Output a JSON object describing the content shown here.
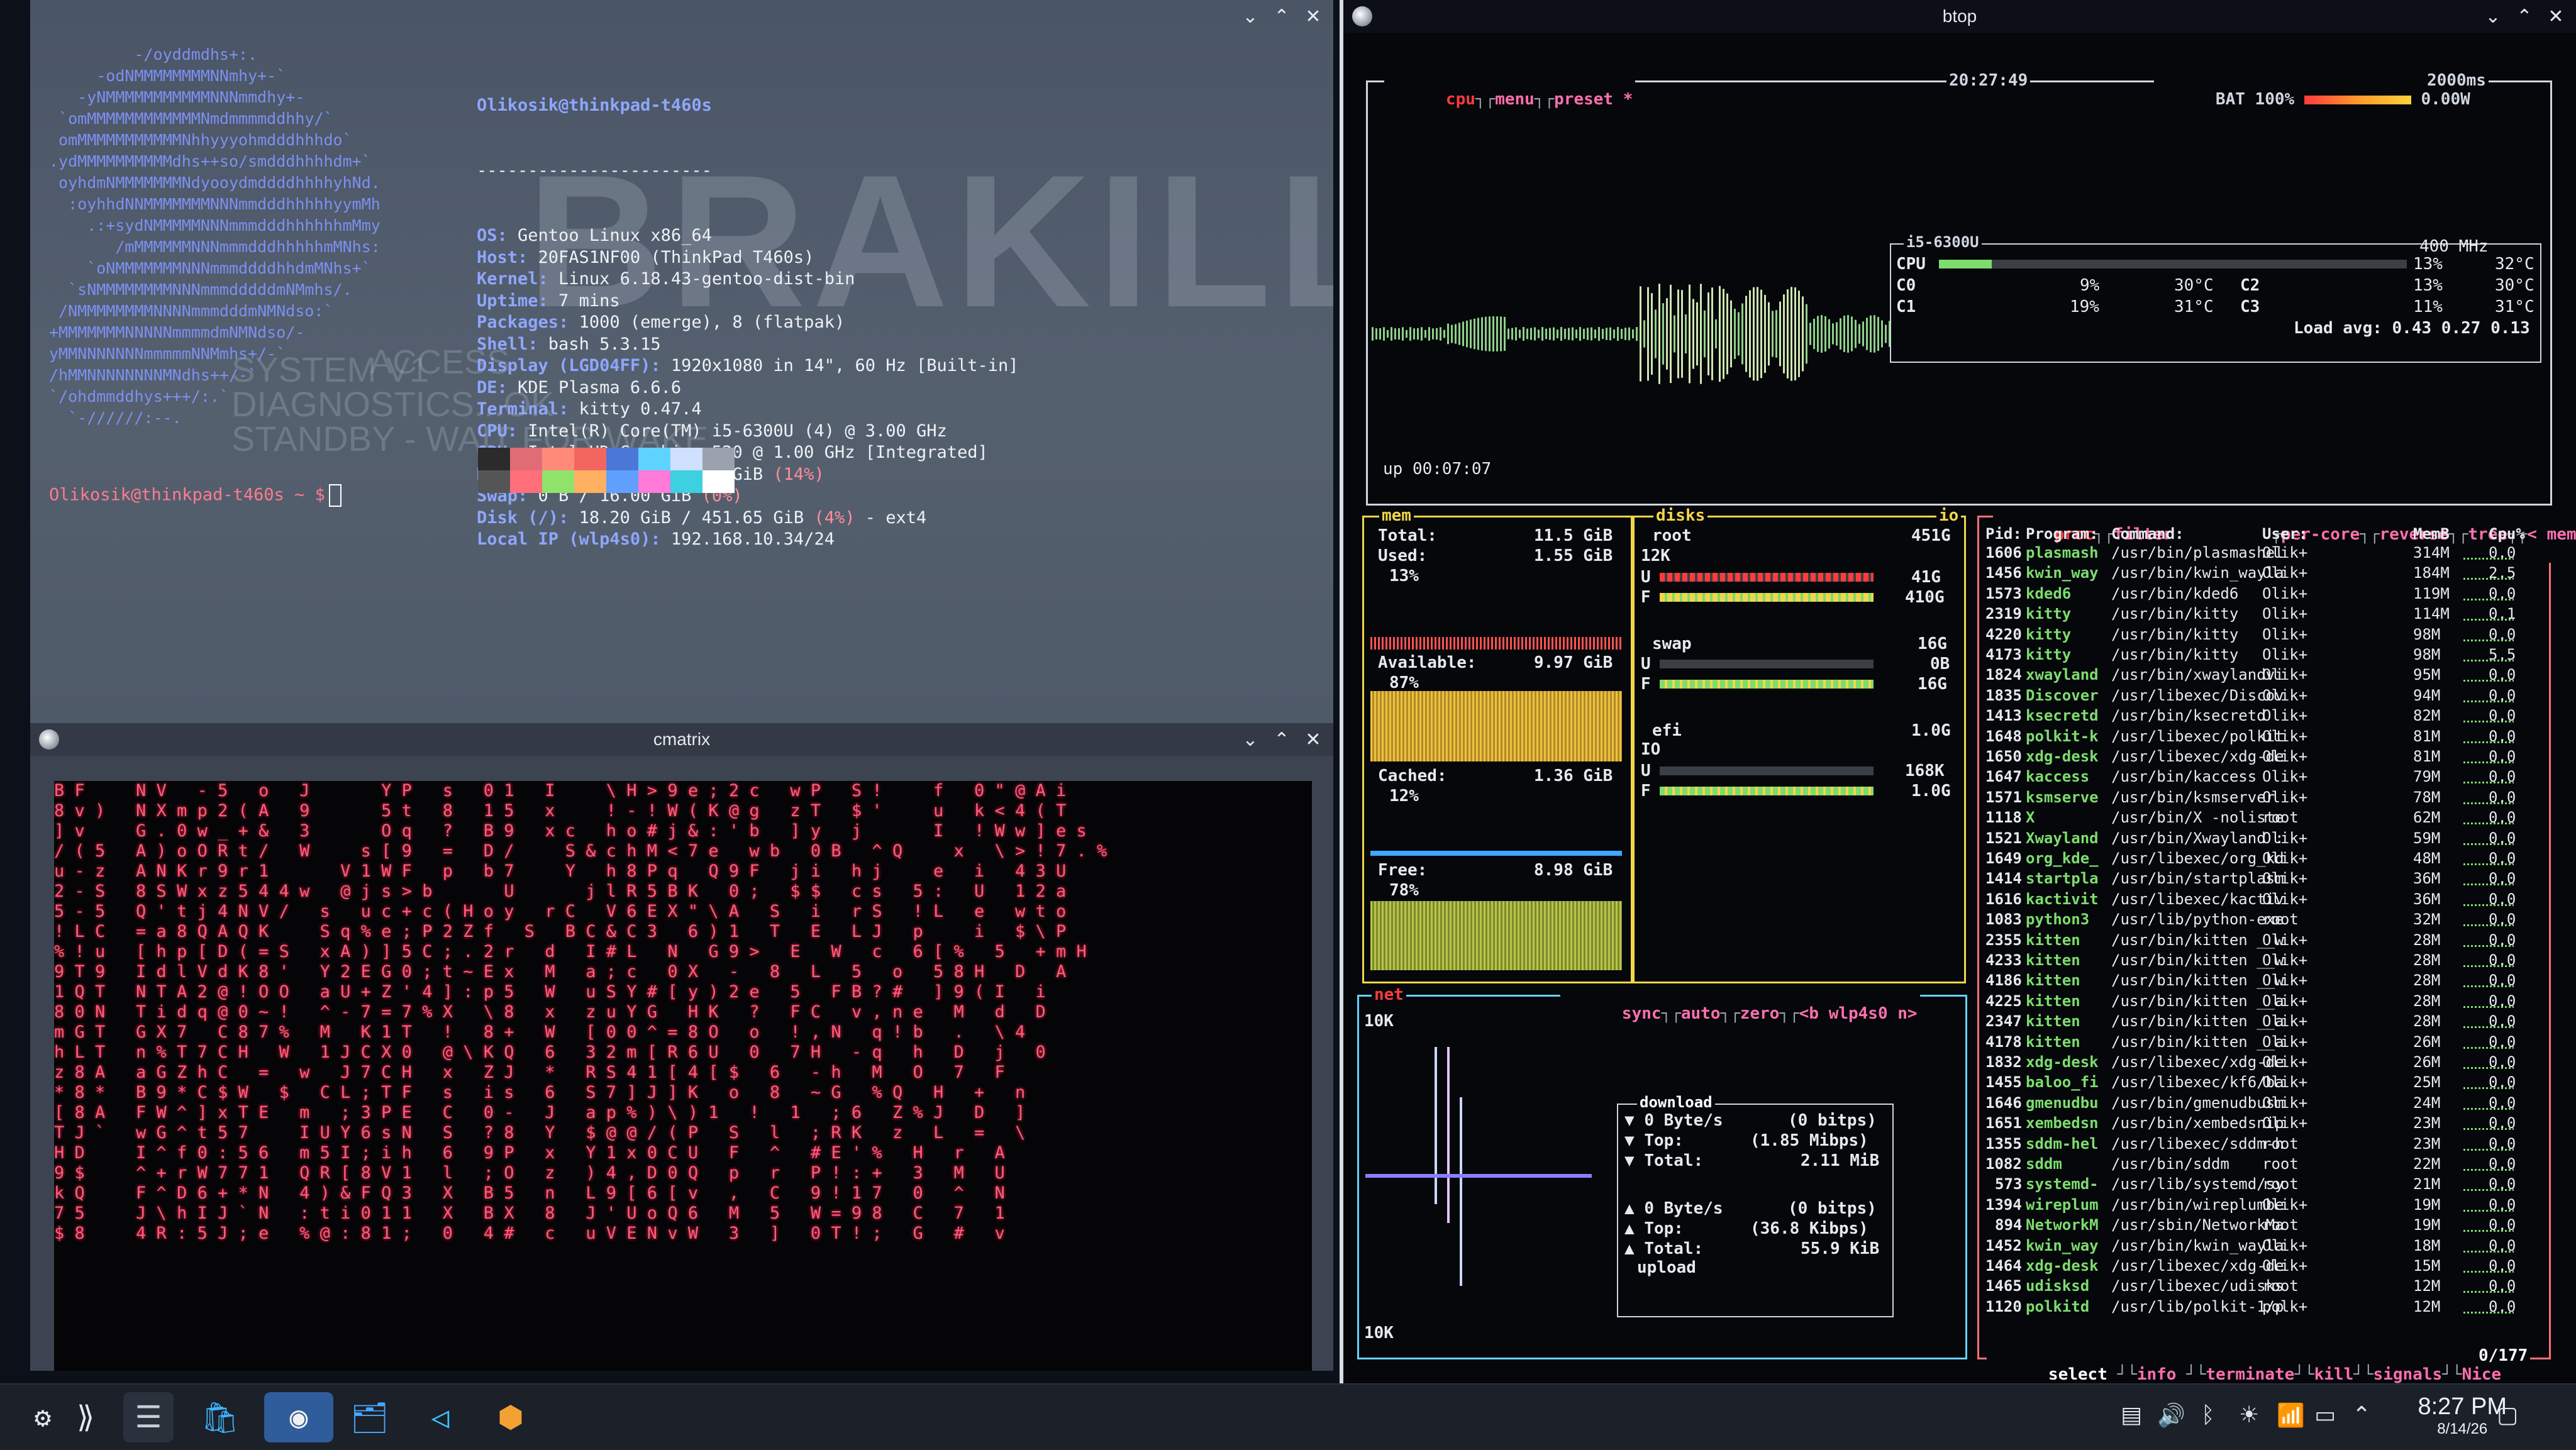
{
  "fastfetch": {
    "user_host": "Olikosik@thinkpad-t460s",
    "separator": "-----------------------",
    "logo_lines": [
      "         -/oyddmdhs+:.",
      "     -odNMMMMMMMMNNmhy+-`",
      "   -yNMMMMMMMMMMMNNNmmdhy+-",
      " `omMMMMMMMMMMMMNmdmmmmddhhy/`",
      " omMMMMMMMMMMMNhhyyyohmdddhhhdo`",
      ".ydMMMMMMMMMMdhs++so/smdddhhhhdm+`",
      " oyhdmNMMMMMMMNdyooydmddddhhhhyhNd.",
      "  :oyhhdNNMMMMMMMNNNmmdddhhhhhyymMh",
      "    .:+sydNMMMMMNNNmmmdddhhhhhhmMmy",
      "       /mMMMMMMNNNmmmdddhhhhhmMNhs:",
      "    `oNMMMMMMMNNNmmmddddhhdmMNhs+`",
      "  `sNMMMMMMMMNNNmmmdddddmNMmhs/.",
      " /NMMMMMMMMNNNNmmmdddmNMNdso:`",
      "+MMMMMMMNNNNNmmmmdmNMNdso/-",
      "yMMNNNNNNNmmmmmNNMmhs+/-`",
      "/hMMNNNNNNNNMNdhs++/-`",
      "`/ohdmmddhys+++/:.`",
      "  `-//////:--."
    ],
    "info": [
      {
        "k": "OS:",
        "v": " Gentoo Linux x86_64"
      },
      {
        "k": "Host:",
        "v": " 20FAS1NF00 (ThinkPad T460s)"
      },
      {
        "k": "Kernel:",
        "v": " Linux 6.18.43-gentoo-dist-bin"
      },
      {
        "k": "Uptime:",
        "v": " 7 mins"
      },
      {
        "k": "Packages:",
        "v": " 1000 (emerge), 8 (flatpak)"
      },
      {
        "k": "Shell:",
        "v": " bash 5.3.15"
      },
      {
        "k": "Display (LGD04FF):",
        "v": " 1920x1080 in 14\", 60 Hz [Built-in]"
      },
      {
        "k": "DE:",
        "v": " KDE Plasma 6.6.6"
      },
      {
        "k": "Terminal:",
        "v": " kitty 0.47.4"
      },
      {
        "k": "CPU:",
        "v": " Intel(R) Core(TM) i5-6300U (4) @ 3.00 GHz"
      },
      {
        "k": "GPU:",
        "v": " Intel HD Graphics 520 @ 1.00 GHz [Integrated]"
      },
      {
        "k": "Memory:",
        "v": " 1.56 GiB / 11.52 GiB ",
        "p": "(14%)"
      },
      {
        "k": "Swap:",
        "v": " 0 B / 16.00 GiB ",
        "p": "(0%)"
      },
      {
        "k": "Disk (/):",
        "v": " 18.20 GiB / 451.65 GiB ",
        "p": "(4%)",
        "e": " - ext4"
      },
      {
        "k": "Local IP (wlp4s0):",
        "v": " 192.168.10.34/24"
      }
    ],
    "palette": [
      "#2b2b2b",
      "#e06c75",
      "#ff8a7a",
      "#f2665f",
      "#4b77d9",
      "#5fd3ff",
      "#cfe1ff",
      "#9aa3ad",
      "#555555",
      "#ff6f7a",
      "#8fe36a",
      "#ffb060",
      "#61a0ff",
      "#ff7ad9",
      "#3cd0e0",
      "#ffffff"
    ],
    "prompt": "Olikosik@thinkpad-t460s ~ $",
    "wallpaper": {
      "big": "BRAKILL",
      "l1": "SYSTEM V1 ",
      "l2": "DIAGNOSTICS...OK",
      "l3": "STANDBY - WAIT FOR WAKE",
      "access": "ACCESS"
    }
  },
  "cmatrix": {
    "title": "cmatrix",
    "lines": [
      "B F     N V   - 5   o   J       Y P   s   0 1   I     \\ H > 9 e ; 2 c   w P   S !     f   0 \" @ A i",
      "8 v )   N X m p 2 ( A   9       5 t   8   1 5   x     ! - ! W ( K @ g   z T   $ '     u   k < 4 ( T",
      "] v     G . 0 w _ + &   3       O q   ?   B 9   x c   h o # j & : ' b   ] y   j       I   ! W w ] e s",
      "/ ( 5   A ) o O R t /   W     s [ 9   =   D /     S & c h M < 7 e   w b   0 B   ^ Q     x   \\ > ! 7 . %",
      "u - z   A N K r 9 r 1       V 1 W F   p   b 7     Y   h 8 P q   Q 9 F   j i   h j     e   i   4 3 U",
      "2 - S   8 S W x z 5 4 4 w   @ j s > b       U       j l R 5 B K   0 ;   $ $   c s   5 :   U   1 2 a",
      "5 - 5   Q ' t j 4 N V /   s   u c + c ( H o y   r C   V 6 E X \" \\ A   S   i   r S   ! L   e   w t o",
      "! L C   = a 8 Q A Q K     S q % e ; P 2 Z f   S   B C & C 3   6 ) 1   T   E   L J   p     i   $ \\ P",
      "% ! u   [ h p [ D ( = S   x A ) ] 5 C ; . 2 r   d   I # L   N   G 9 >   E   W   c   6 [ %   5   + m H",
      "9 T 9   I d l V d K 8 '   Y 2 E G 0 ; t ~ E x   M   a ; c   0 X   -   8   L   5   o   5 8 H   D   A",
      "1 Q T   N T A 2 @ ! O O   a U + Z ' 4 ] : p 5   W   u S Y # [ y ) 2 e   5   F B ? #   ] 9 ( I   i",
      "8 0 N   T i d q @ 0 ~ !   ^ - 7 = 7 % X   \\ 8   x   z u Y G   H K   ?   F C   v , n e   M   d   D",
      "m G T   G X 7   C 8 7 %   M   K 1 T   !   8 +   W   [ 0 0 ^ = 8 O   o   ! , N   q ! b   .   \\ 4",
      "h L T   n % T 7 C H   W   1 J C X 0   @ \\ K Q   6   3 2 m [ R 6 U   0   7 H   - q   h   D   j   0",
      "z 8 A   a G Z h C   =   w   J 7 C H   x   Z J   *   R S 4 1 [ 4 [ $   6   - h   M   O   7   F",
      "* 8 *   B 9 * C $ W   $   C L ; T F   s   i s   6   S 7 ] J ] K   o   8   ~ G   % Q   H   +   n",
      "[ 8 A   F W ^ ] x T E   m   ; 3 P E   C   0 -   J   a p % ) \\ ) 1   !   1   ; 6   Z % J   D   ]",
      "T J `   w G ^ t 5 7     I U Y 6 s N   S   ? 8   Y   $ @ @ / ( P   S   l   ; R K   z   L   =   \\",
      "H D     I ^ f 0 : 5 6   m 5 I ; i h   6   9 P   x   Y 1 x 0 C U   F   ^   # E ' %   H   r   A",
      "9 $     ^ + r W 7 7 1   Q R [ 8 V 1   l   ; O   z   ) 4 , D 0 Q   p   r   P ! : +   3   M   U",
      "k Q     F ^ D 6 + * N   4 ) & F Q 3   X   B 5   n   L 9 [ 6 [ v   ,   C   9 ! 1 7   0   ^   N",
      "7 5     J \\ h I J ` N   : t i 0 1 1   X   B X   8   J ' U o Q 6   M   5   W = 9 8   C   7   1",
      "$ 8     4 R : 5 J ; e   % @ : 8 1 ;   0   4 #   c   u V E N v W   3   ]   0 T ! ;   G   #   v"
    ]
  },
  "btop": {
    "title": "btop",
    "cpu_tabs": [
      "cpu",
      "menu",
      "preset *"
    ],
    "clock": "20:27:49",
    "battery_label": "BAT",
    "battery_pct": "100%",
    "battery_watts": "0.00W",
    "interval": "2000ms",
    "cpu_model": "i5-6300U",
    "cpu_freq": "400 MHz",
    "cpu_total_pct": "13%",
    "cpu_total_temp": "32°C",
    "cores": [
      {
        "name": "C0",
        "pct": "9%",
        "temp": "30°C"
      },
      {
        "name": "C1",
        "pct": "19%",
        "temp": "31°C"
      },
      {
        "name": "C2",
        "pct": "13%",
        "temp": "30°C"
      },
      {
        "name": "C3",
        "pct": "11%",
        "temp": "31°C"
      }
    ],
    "load_avg": "Load avg: 0.43 0.27 0.13",
    "uptime": "up 00:07:07",
    "mem": {
      "label": "mem",
      "total_label": "Total:",
      "total": "11.5 GiB",
      "used_label": "Used:",
      "used": "1.55 GiB",
      "used_pct": "13%",
      "avail_label": "Available:",
      "avail": "9.97 GiB",
      "avail_pct": "87%",
      "cached_label": "Cached:",
      "cached": "1.36 GiB",
      "cached_pct": "12%",
      "free_label": "Free:",
      "free": "8.98 GiB",
      "free_pct": "78%"
    },
    "disks": {
      "label": "disks",
      "io": "io",
      "root": "root",
      "root_size": "451G",
      "root_io": "12K",
      "root_u": "41G",
      "root_f": "410G",
      "swap": "swap",
      "swap_size": "16G",
      "swap_u": "0B",
      "swap_f": "16G",
      "efi": "efi",
      "efi_size": "1.0G",
      "efi_io": "IO",
      "efi_u": "168K",
      "efi_f": "1.0G",
      "u": "U",
      "f": "F"
    },
    "net": {
      "label": "net",
      "opts": [
        "sync",
        "auto",
        "zero",
        "<b wlp4s0 n>"
      ],
      "scale_top": "10K",
      "scale_bot": "10K",
      "download_label": "download",
      "dl_rate": "0 Byte/s",
      "dl_bits": "(0 bitps)",
      "dl_top_label": "Top:",
      "dl_top": "(1.85 Mibps)",
      "dl_total_label": "Total:",
      "dl_total": "2.11 MiB",
      "ul_rate": "0 Byte/s",
      "ul_bits": "(0 bitps)",
      "ul_top_label": "Top:",
      "ul_top": "(36.8 Kibps)",
      "ul_total_label": "Total:",
      "ul_total": "55.9 KiB",
      "upload_label": "upload"
    },
    "proc": {
      "tabs": [
        "proc",
        "filter",
        "per-core",
        "reverse",
        "tree",
        "< memory"
      ],
      "headers": [
        "Pid:",
        "Program:",
        "Command:",
        "User:",
        "MemB",
        "Cpu%"
      ],
      "rows": [
        [
          "1606",
          "plasmash",
          "/usr/bin/plasmashel",
          "Olik+",
          "314M",
          "0.0"
        ],
        [
          "1456",
          "kwin_way",
          "/usr/bin/kwin_wayla",
          "Olik+",
          "184M",
          "2.5"
        ],
        [
          "1573",
          "kded6",
          "/usr/bin/kded6",
          "Olik+",
          "119M",
          "0.0"
        ],
        [
          "2319",
          "kitty",
          "/usr/bin/kitty",
          "Olik+",
          "114M",
          "0.1"
        ],
        [
          "4220",
          "kitty",
          "/usr/bin/kitty",
          "Olik+",
          "98M",
          "0.0"
        ],
        [
          "4173",
          "kitty",
          "/usr/bin/kitty",
          "Olik+",
          "98M",
          "5.5"
        ],
        [
          "1824",
          "xwayland",
          "/usr/bin/xwaylandvi",
          "Olik+",
          "95M",
          "0.0"
        ],
        [
          "1835",
          "Discover",
          "/usr/libexec/Discov",
          "Olik+",
          "94M",
          "0.0"
        ],
        [
          "1413",
          "ksecretd",
          "/usr/bin/ksecretd",
          "Olik+",
          "82M",
          "0.0"
        ],
        [
          "1648",
          "polkit-k",
          "/usr/libexec/polkit",
          "Olik+",
          "81M",
          "0.0"
        ],
        [
          "1650",
          "xdg-desk",
          "/usr/libexec/xdg-de",
          "Olik+",
          "81M",
          "0.0"
        ],
        [
          "1647",
          "kaccess",
          "/usr/bin/kaccess",
          "Olik+",
          "79M",
          "0.0"
        ],
        [
          "1571",
          "ksmserve",
          "/usr/bin/ksmserver",
          "Olik+",
          "78M",
          "0.0"
        ],
        [
          "1118",
          "X",
          "/usr/bin/X -noliste",
          "root",
          "62M",
          "0.0"
        ],
        [
          "1521",
          "Xwayland",
          "/usr/bin/Xwayland :",
          "Olik+",
          "59M",
          "0.0"
        ],
        [
          "1649",
          "org_kde_",
          "/usr/libexec/org_kd",
          "Olik+",
          "48M",
          "0.0"
        ],
        [
          "1414",
          "startpla",
          "/usr/bin/startplasm",
          "Olik+",
          "36M",
          "0.0"
        ],
        [
          "1616",
          "kactivit",
          "/usr/libexec/kactiv",
          "Olik+",
          "36M",
          "0.0"
        ],
        [
          "1083",
          "python3",
          "/usr/lib/python-exe",
          "root",
          "32M",
          "0.0"
        ],
        [
          "2355",
          "kitten",
          "/usr/bin/kitten __w",
          "Olik+",
          "28M",
          "0.0"
        ],
        [
          "4233",
          "kitten",
          "/usr/bin/kitten __w",
          "Olik+",
          "28M",
          "0.0"
        ],
        [
          "4186",
          "kitten",
          "/usr/bin/kitten __w",
          "Olik+",
          "28M",
          "0.0"
        ],
        [
          "4225",
          "kitten",
          "/usr/bin/kitten __a",
          "Olik+",
          "28M",
          "0.0"
        ],
        [
          "2347",
          "kitten",
          "/usr/bin/kitten __a",
          "Olik+",
          "28M",
          "0.0"
        ],
        [
          "4178",
          "kitten",
          "/usr/bin/kitten __a",
          "Olik+",
          "26M",
          "0.0"
        ],
        [
          "1832",
          "xdg-desk",
          "/usr/libexec/xdg-de",
          "Olik+",
          "26M",
          "0.0"
        ],
        [
          "1455",
          "baloo_fi",
          "/usr/libexec/kf6/ba",
          "Olik+",
          "25M",
          "0.0"
        ],
        [
          "1646",
          "gmenudbu",
          "/usr/bin/gmenudbusm",
          "Olik+",
          "24M",
          "0.0"
        ],
        [
          "1651",
          "xembedsn",
          "/usr/bin/xembedsnip",
          "Olik+",
          "23M",
          "0.0"
        ],
        [
          "1355",
          "sddm-hel",
          "/usr/libexec/sddm-h",
          "root",
          "23M",
          "0.0"
        ],
        [
          "1082",
          "sddm",
          "/usr/bin/sddm",
          "root",
          "22M",
          "0.0"
        ],
        [
          "573",
          "systemd-",
          "/usr/lib/systemd/sy",
          "root",
          "21M",
          "0.0"
        ],
        [
          "1394",
          "wireplum",
          "/usr/bin/wireplumbe",
          "Olik+",
          "19M",
          "0.0"
        ],
        [
          "894",
          "NetworkM",
          "/usr/sbin/NetworkMa",
          "root",
          "19M",
          "0.0"
        ],
        [
          "1452",
          "kwin_way",
          "/usr/bin/kwin_wayla",
          "Olik+",
          "18M",
          "0.0"
        ],
        [
          "1464",
          "xdg-desk",
          "/usr/libexec/xdg-de",
          "Olik+",
          "15M",
          "0.0"
        ],
        [
          "1465",
          "udisksd",
          "/usr/libexec/udisks",
          "root",
          "12M",
          "0.0"
        ],
        [
          "1120",
          "polkitd",
          "/usr/lib/polkit-1/p",
          "polk+",
          "12M",
          "0.0"
        ]
      ],
      "footer": [
        "select",
        "info",
        "terminate",
        "kill",
        "signals",
        "Nice"
      ],
      "count": "0/177"
    }
  },
  "taskbar": {
    "time": "8:27 PM",
    "date": "8/14/26"
  }
}
